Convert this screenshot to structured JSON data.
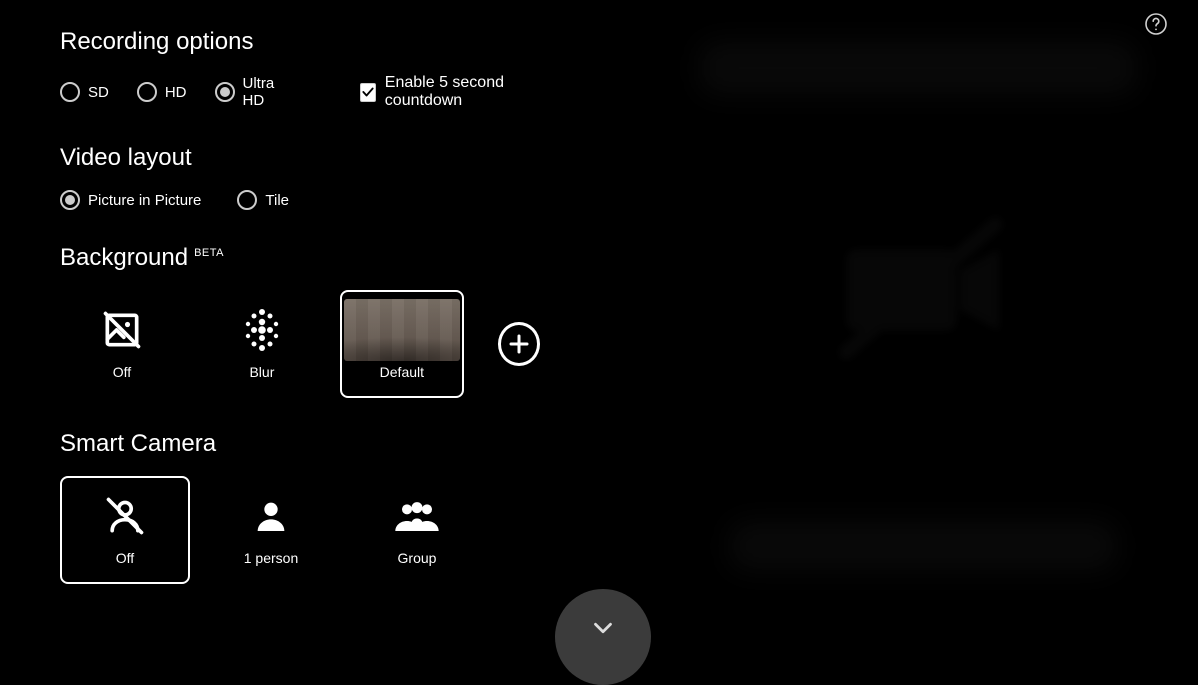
{
  "help_tooltip": "Help",
  "recording": {
    "title": "Recording options",
    "quality": [
      {
        "id": "sd",
        "label": "SD",
        "checked": false
      },
      {
        "id": "hd",
        "label": "HD",
        "checked": false
      },
      {
        "id": "uhd",
        "label": "Ultra HD",
        "checked": true
      }
    ],
    "countdown": {
      "label": "Enable 5 second countdown",
      "checked": true
    }
  },
  "layout": {
    "title": "Video layout",
    "options": [
      {
        "id": "pip",
        "label": "Picture in Picture",
        "checked": true
      },
      {
        "id": "tile",
        "label": "Tile",
        "checked": false
      }
    ]
  },
  "background": {
    "title": "Background",
    "badge": "BETA",
    "options": [
      {
        "id": "off",
        "label": "Off",
        "selected": false,
        "icon": "image-off"
      },
      {
        "id": "blur",
        "label": "Blur",
        "selected": false,
        "icon": "blur"
      },
      {
        "id": "default",
        "label": "Default",
        "selected": true,
        "icon": "thumb"
      }
    ],
    "add_label": "Add background"
  },
  "smart_camera": {
    "title": "Smart Camera",
    "options": [
      {
        "id": "sc-off",
        "label": "Off",
        "selected": true,
        "icon": "person-off"
      },
      {
        "id": "sc-1",
        "label": "1 person",
        "selected": false,
        "icon": "person"
      },
      {
        "id": "sc-group",
        "label": "Group",
        "selected": false,
        "icon": "group"
      }
    ]
  },
  "expand_label": "Collapse"
}
